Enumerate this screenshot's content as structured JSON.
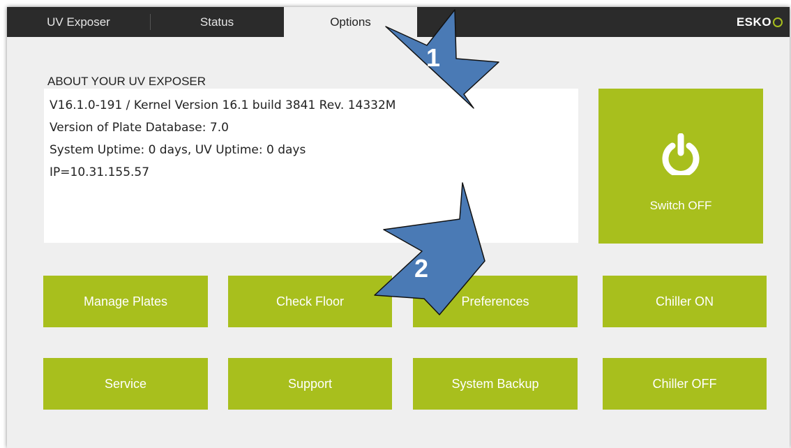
{
  "tabs": [
    {
      "label": "UV Exposer",
      "active": false
    },
    {
      "label": "Status",
      "active": false
    },
    {
      "label": "Options",
      "active": true
    }
  ],
  "brand": {
    "logo": "ESKO",
    "logo_icon": "esko-mark-icon"
  },
  "about": {
    "title": "ABOUT YOUR UV EXPOSER",
    "lines": [
      "V16.1.0-191 / Kernel Version 16.1 build 3841 Rev. 14332M",
      "Version of Plate Database: 7.0",
      "System Uptime: 0 days, UV Uptime: 0 days",
      "IP=10.31.155.57"
    ]
  },
  "power": {
    "label": "Switch OFF",
    "icon": "power-icon"
  },
  "buttons_row1": [
    "Manage Plates",
    "Check Floor",
    "Preferences",
    "Chiller ON"
  ],
  "buttons_row2": [
    "Service",
    "Support",
    "System Backup",
    "Chiller OFF"
  ],
  "annotations": {
    "arrow1": "1",
    "arrow2": "2",
    "arrow_color": "#4a7ab5"
  },
  "colors": {
    "accent": "#a8bf1d",
    "topbar": "#2b2b2b",
    "background": "#efefef"
  }
}
